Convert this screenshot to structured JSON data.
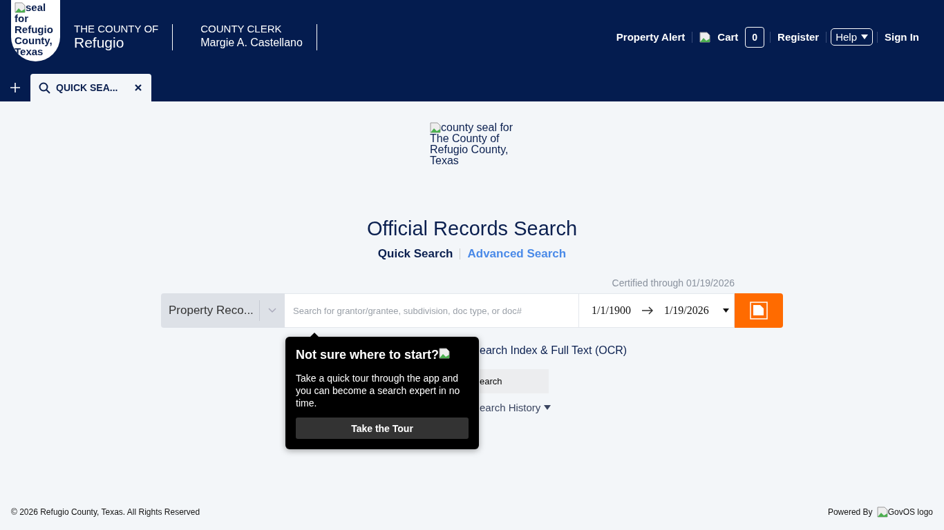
{
  "header": {
    "seal_alt": "seal for Refugio County, Texas",
    "county_prefix": "THE COUNTY OF",
    "county_name": "Refugio",
    "office_title": "COUNTY CLERK",
    "office_holder": "Margie A. Castellano",
    "nav": [
      {
        "kind": "link",
        "label": "Property Alert"
      },
      {
        "kind": "cart",
        "label": "Cart",
        "count": "0"
      },
      {
        "kind": "link",
        "label": "Register"
      },
      {
        "kind": "dropdown",
        "label": "Help"
      },
      {
        "kind": "link",
        "label": "Sign In"
      }
    ]
  },
  "tabs": [
    {
      "label": "QUICK SEA...",
      "selected": true
    }
  ],
  "main": {
    "seal_alt": "county seal for The County of Refugio County, Texas",
    "title": "Official Records Search",
    "modes": [
      {
        "label": "Quick Search",
        "selected": true
      },
      {
        "label": "Advanced Search",
        "selected": false
      }
    ],
    "certified": "Certified through 01/19/2026",
    "search": {
      "category": "Property Reco...",
      "placeholder": "Search for grantor/grantee, subdivision, doc type, or doc#",
      "date_from": "1/1/1900",
      "date_to": "1/19/2026"
    },
    "option_text": "earch Index & Full Text (OCR)",
    "secondary_button": "earch",
    "history_label": "earch History"
  },
  "popover": {
    "title": "Not sure where to start?",
    "body": "Take a quick tour through the app and you can become a search expert in no time.",
    "button": "Take the Tour"
  },
  "footer": {
    "copyright": "© 2026 Refugio County, Texas. All Rights Reserved",
    "powered_by": "Powered By",
    "logo_alt": "GovOS logo"
  }
}
